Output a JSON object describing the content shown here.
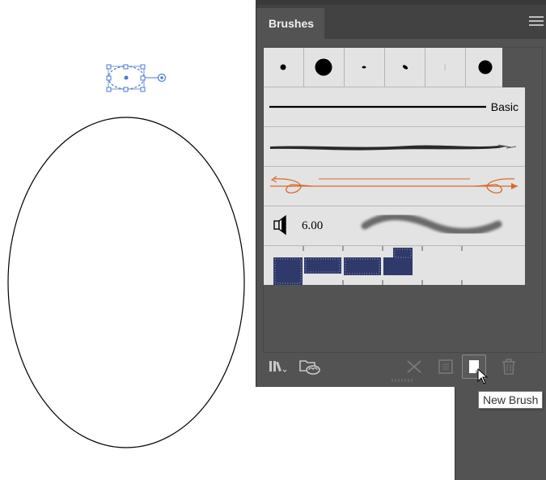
{
  "panel": {
    "tab_label": "Brushes",
    "menu_icon": "hamburger-icon"
  },
  "brushes": {
    "basic_label": "Basic",
    "calligraphic_size": "6.00",
    "pressure_icon": "speaker-icon"
  },
  "footer": {
    "library_icon": "brush-libraries-icon",
    "cloud_icon": "libraries-panel-icon",
    "remove_stroke_icon": "remove-brush-stroke-icon",
    "options_icon": "options-of-selected-object-icon",
    "new_brush_icon": "new-brush-icon",
    "delete_icon": "trash-icon"
  },
  "tooltip": {
    "text": "New Brush"
  },
  "colors": {
    "panel_bg": "#535353",
    "tab_bar_bg": "#424242",
    "selection_blue": "#4a7ad6",
    "art_brush_orange": "#d8692f",
    "pattern_navy": "#2f3a6b"
  }
}
